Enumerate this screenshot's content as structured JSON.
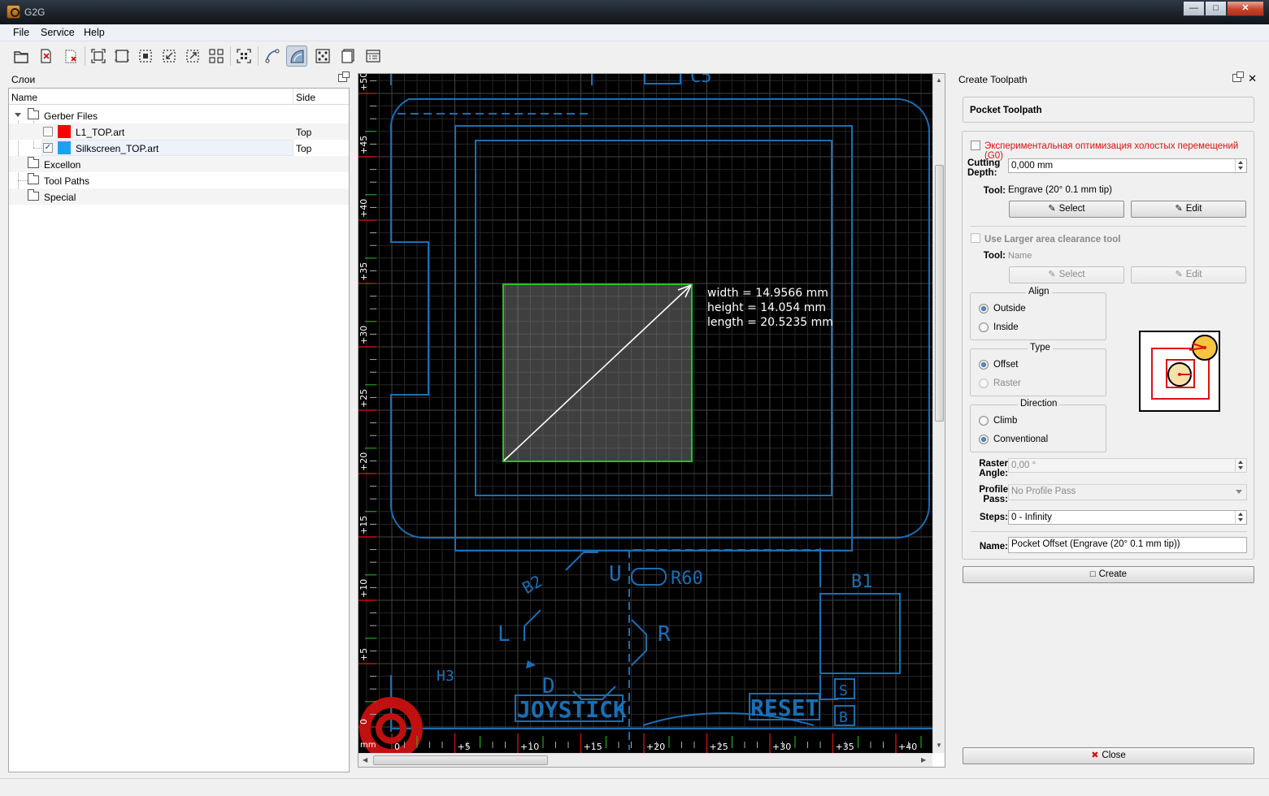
{
  "window": {
    "title": "G2G"
  },
  "menu": [
    "File",
    "Service",
    "Help"
  ],
  "toolbar": {
    "items": [
      "open-icon",
      "close-file-icon",
      "delete-icon",
      "zoom-fit-icon",
      "zoom-to-page-icon",
      "zoom-selection-icon",
      "zoom-in-icon",
      "zoom-out-icon",
      "zoom-100-icon",
      "select-all-icon",
      "profile-toolpath-icon",
      "pocket-toolpath-icon",
      "drilling-icon",
      "material-setup-icon",
      "toolpath-list-icon"
    ],
    "active": "pocket-toolpath-icon"
  },
  "layers_panel": {
    "title": "Слои",
    "columns": {
      "name": "Name",
      "side": "Side"
    },
    "tree": [
      {
        "label": "Gerber Files",
        "expanded": true,
        "children": [
          {
            "label": "L1_TOP.art",
            "side": "Top",
            "checked": false,
            "color": "#ff0000"
          },
          {
            "label": "Silkscreen_TOP.art",
            "side": "Top",
            "checked": true,
            "color": "#1ea0f0"
          }
        ]
      },
      {
        "label": "Excellon"
      },
      {
        "label": "Tool Paths"
      },
      {
        "label": "Special"
      }
    ]
  },
  "canvas": {
    "unit": "mm",
    "x_ticks": [
      "0",
      "+5",
      "+10",
      "+15",
      "+20",
      "+25",
      "+30",
      "+35",
      "+40"
    ],
    "y_ticks": [
      "0",
      "+5",
      "+10",
      "+15",
      "+20",
      "+25",
      "+30",
      "+35",
      "+40",
      "+45",
      "+50"
    ],
    "measure": {
      "width": "width = 14.9566 mm",
      "height": "height = 14.054 mm",
      "length": "length = 20.5235 mm"
    },
    "silk_labels": [
      "C5",
      "B2",
      "U",
      "R60",
      "B1",
      "L",
      "R",
      "H3",
      "D",
      "JOYSTICK",
      "RESET",
      "S",
      "B"
    ],
    "colors": {
      "silk": "#1a6fb5",
      "grid": "#3a3a3a",
      "selection": "#22c422",
      "copper": "#c01010"
    }
  },
  "toolpath_panel": {
    "title": "Create Toolpath",
    "heading": "Pocket Toolpath",
    "exp_opt_label": "Экспериментальная оптимизация холостых перемещений (G0)",
    "exp_opt_checked": false,
    "cutting_depth_label": "Cutting Depth:",
    "cutting_depth_value": "0,000 mm",
    "tool_label": "Tool:",
    "tool_value": "Engrave (20° 0.1 mm tip)",
    "select_label": "Select",
    "edit_label": "Edit",
    "larger_area_label": "Use Larger area clearance tool",
    "tool2_label": "Tool:",
    "tool2_placeholder": "Name",
    "align": {
      "title": "Align",
      "options": [
        "Outside",
        "Inside"
      ],
      "selected": "Outside"
    },
    "type": {
      "title": "Type",
      "options": [
        "Offset",
        "Raster"
      ],
      "selected": "Offset"
    },
    "direction": {
      "title": "Direction",
      "options": [
        "Climb",
        "Conventional"
      ],
      "selected": "Conventional"
    },
    "raster_angle_label": "Raster Angle:",
    "raster_angle_value": "0,00 °",
    "profile_pass_label": "Profile Pass:",
    "profile_pass_value": "No Profile Pass",
    "steps_label": "Steps:",
    "steps_value": "0 - Infinity",
    "name_label": "Name:",
    "name_value": "Pocket Offset (Engrave (20° 0.1 mm tip))",
    "create_label": "Create",
    "close_label": "Close"
  }
}
